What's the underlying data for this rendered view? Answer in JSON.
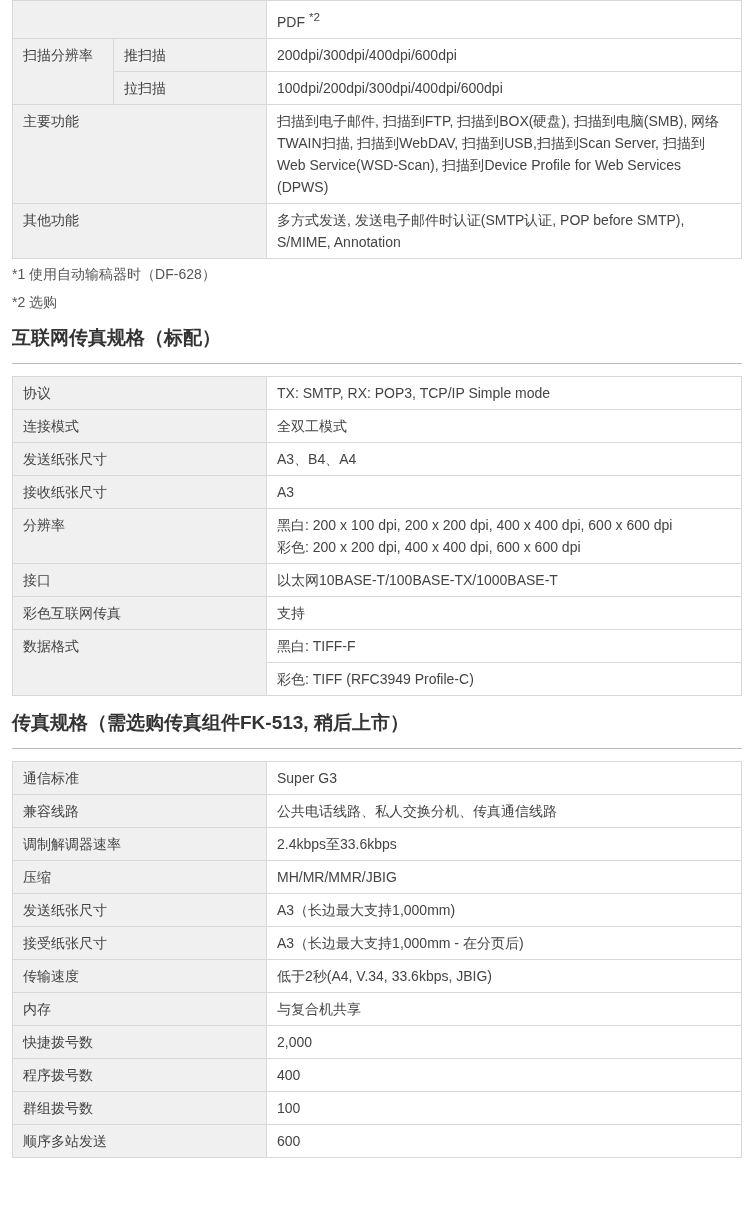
{
  "sections": [
    {
      "rows": [
        {
          "kind": "single",
          "lines": [
            "PDF $^{*2}$"
          ]
        },
        {
          "kind": "split",
          "label": "扫描分辨率",
          "subrows": [
            {
              "label": "推扫描",
              "value": "200dpi/300dpi/400dpi/600dpi"
            },
            {
              "label": "拉扫描",
              "value": "100dpi/200dpi/300dpi/400dpi/600dpi"
            }
          ]
        },
        {
          "kind": "single",
          "label": "主要功能",
          "lines": [
            "扫描到电子邮件, 扫描到FTP, 扫描到BOX(硬盘), 扫描到电脑(SMB), 网络TWAIN扫描, 扫描到WebDAV, 扫描到USB,扫描到Scan Server, 扫描到Web Service(WSD-Scan), 扫描到Device Profile for Web Services (DPWS)"
          ]
        },
        {
          "kind": "single",
          "label": "其他功能",
          "lines": [
            "多方式发送, 发送电子邮件时认证(SMTP认证, POP before SMTP), S/MIME, Annotation"
          ]
        }
      ],
      "notes": [
        "*1  使用自动输稿器时（DF-628）",
        "*2  选购"
      ]
    },
    {
      "title": "互联网传真规格（标配）",
      "rows": [
        {
          "kind": "single",
          "label": "协议",
          "lines": [
            "TX: SMTP, RX: POP3, TCP/IP Simple mode"
          ]
        },
        {
          "kind": "single",
          "label": "连接模式",
          "lines": [
            "全双工模式"
          ]
        },
        {
          "kind": "single",
          "label": "发送纸张尺寸",
          "lines": [
            "A3、B4、A4"
          ]
        },
        {
          "kind": "single",
          "label": "接收纸张尺寸",
          "lines": [
            "A3"
          ]
        },
        {
          "kind": "single",
          "label": "分辨率",
          "lines": [
            "黑白: 200 x 100 dpi, 200 x 200 dpi, 400 x 400 dpi, 600 x 600 dpi",
            "彩色: 200 x 200 dpi, 400 x 400 dpi, 600 x 600 dpi"
          ]
        },
        {
          "kind": "single",
          "label": "接口",
          "lines": [
            "以太网10BASE-T/100BASE-TX/1000BASE-T"
          ]
        },
        {
          "kind": "single",
          "label": "彩色互联网传真",
          "lines": [
            "支持"
          ]
        },
        {
          "kind": "multi",
          "label": "数据格式",
          "values": [
            "黑白: TIFF-F",
            "彩色: TIFF (RFC3949 Profile-C)"
          ]
        }
      ]
    },
    {
      "title": "传真规格（需选购传真组件FK-513, 稍后上市）",
      "rows": [
        {
          "kind": "single",
          "label": "通信标准",
          "lines": [
            "Super G3"
          ]
        },
        {
          "kind": "single",
          "label": "兼容线路",
          "lines": [
            "公共电话线路、私人交换分机、传真通信线路"
          ]
        },
        {
          "kind": "single",
          "label": "调制解调器速率",
          "lines": [
            "2.4kbps至33.6kbps"
          ]
        },
        {
          "kind": "single",
          "label": "压缩",
          "lines": [
            "MH/MR/MMR/JBIG"
          ]
        },
        {
          "kind": "single",
          "label": "发送纸张尺寸",
          "lines": [
            "A3（长边最大支持1,000mm)"
          ]
        },
        {
          "kind": "single",
          "label": "接受纸张尺寸",
          "lines": [
            "A3（长边最大支持1,000mm - 在分页后)"
          ]
        },
        {
          "kind": "single",
          "label": "传输速度",
          "lines": [
            "低于2秒(A4, V.34, 33.6kbps, JBIG)"
          ]
        },
        {
          "kind": "single",
          "label": "内存",
          "lines": [
            "与复合机共享"
          ]
        },
        {
          "kind": "single",
          "label": "快捷拨号数",
          "lines": [
            "2,000"
          ]
        },
        {
          "kind": "single",
          "label": "程序拨号数",
          "lines": [
            "400"
          ]
        },
        {
          "kind": "single",
          "label": "群组拨号数",
          "lines": [
            "100"
          ]
        },
        {
          "kind": "single",
          "label": "顺序多站发送",
          "lines": [
            "600"
          ]
        }
      ]
    }
  ]
}
